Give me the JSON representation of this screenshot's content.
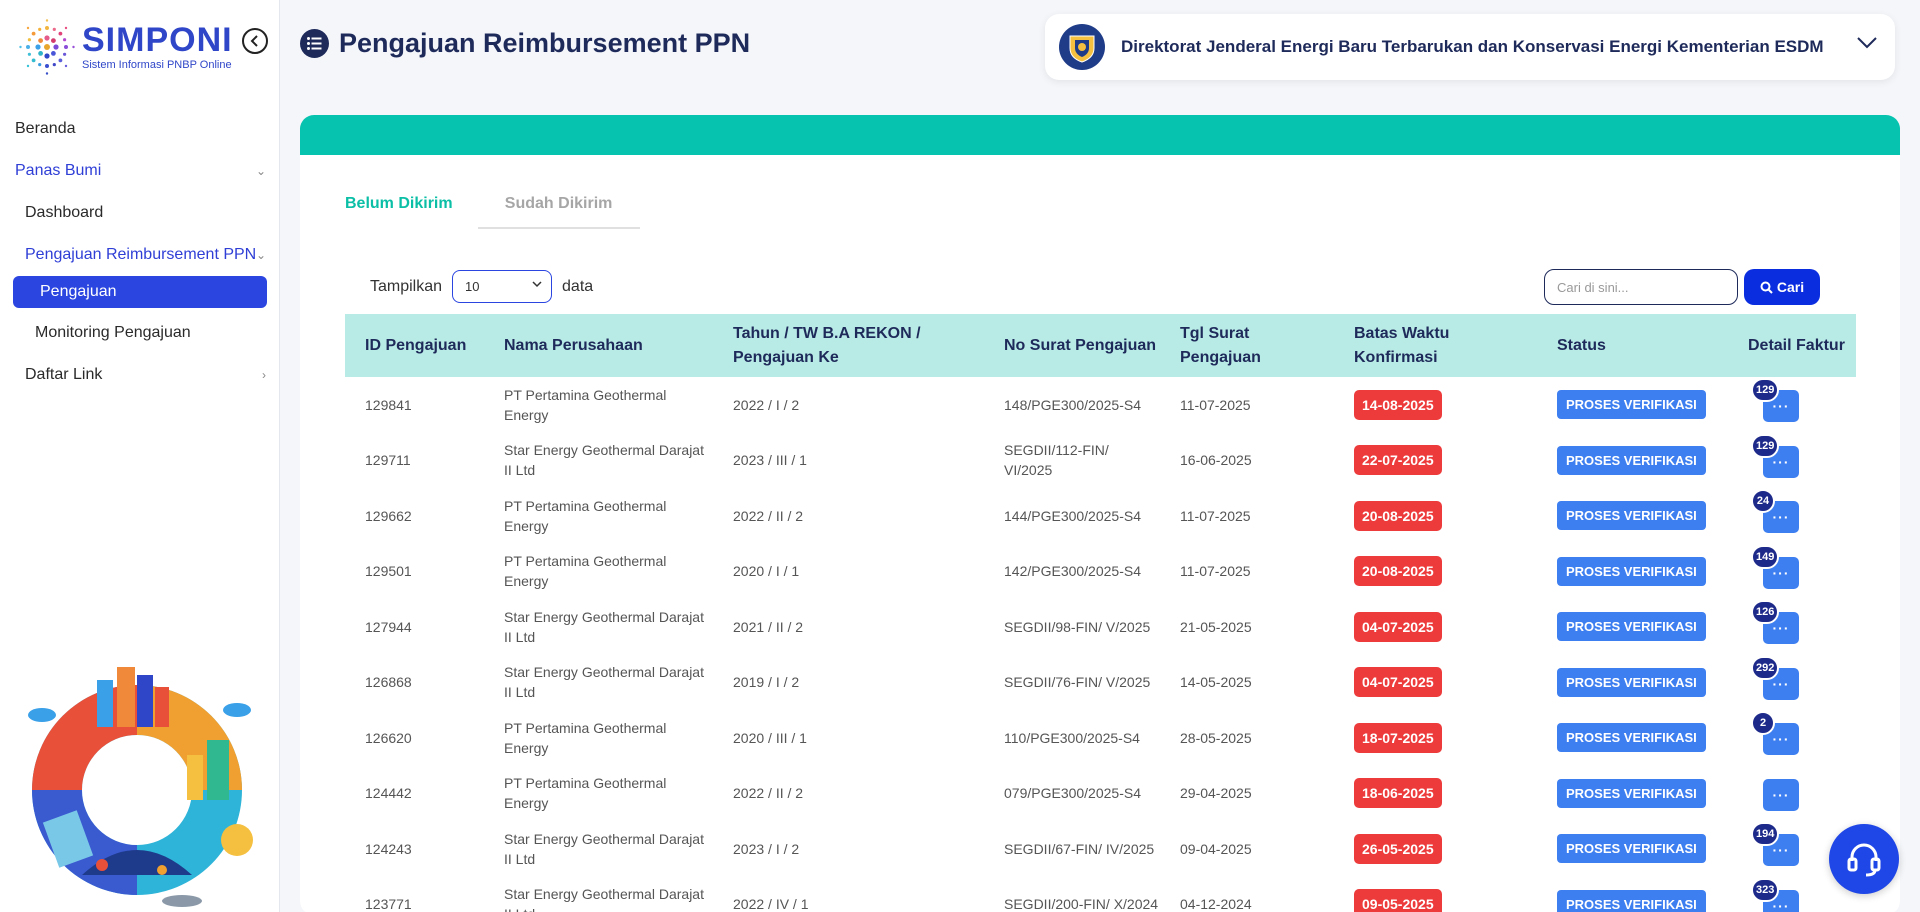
{
  "app": {
    "name": "SIMPONI",
    "tagline": "Sistem Informasi PNBP Online"
  },
  "sidebar": {
    "items": [
      {
        "label": "Beranda"
      },
      {
        "label": "Panas Bumi"
      },
      {
        "label": "Dashboard"
      },
      {
        "label": "Pengajuan Reimbursement PPN"
      },
      {
        "label": "Pengajuan"
      },
      {
        "label": "Monitoring Pengajuan"
      },
      {
        "label": "Daftar Link"
      }
    ]
  },
  "header": {
    "title": "Pengajuan Reimbursement PPN",
    "org_name": "Direktorat Jenderal Energi Baru Terbarukan dan Konservasi Energi Kementerian ESDM"
  },
  "tabs": [
    {
      "label": "Belum Dikirim",
      "active": true
    },
    {
      "label": "Sudah Dikirim",
      "active": false
    }
  ],
  "controls": {
    "show_label": "Tampilkan",
    "page_size": "10",
    "data_label": "data",
    "search_placeholder": "Cari di sini...",
    "search_button": "Cari"
  },
  "table": {
    "columns": [
      "ID Pengajuan",
      "Nama Perusahaan",
      "Tahun / TW B.A REKON / Pengajuan Ke",
      "No Surat Pengajuan",
      "Tgl Surat Pengajuan",
      "Batas Waktu Konfirmasi",
      "Status",
      "Detail Faktur"
    ],
    "detail_button": "···",
    "rows": [
      {
        "id": "129841",
        "company": "PT Pertamina Geothermal Energy",
        "period": "2022 / I / 2",
        "letter_no": "148/PGE300/2025-S4",
        "letter_date": "11-07-2025",
        "deadline": "14-08-2025",
        "status": "PROSES VERIFIKASI",
        "count": "129"
      },
      {
        "id": "129711",
        "company": "Star Energy Geothermal Darajat II Ltd",
        "period": "2023 / III / 1",
        "letter_no": "SEGDII/112-FIN/ VI/2025",
        "letter_date": "16-06-2025",
        "deadline": "22-07-2025",
        "status": "PROSES VERIFIKASI",
        "count": "129"
      },
      {
        "id": "129662",
        "company": "PT Pertamina Geothermal Energy",
        "period": "2022 / II / 2",
        "letter_no": "144/PGE300/2025-S4",
        "letter_date": "11-07-2025",
        "deadline": "20-08-2025",
        "status": "PROSES VERIFIKASI",
        "count": "24"
      },
      {
        "id": "129501",
        "company": "PT Pertamina Geothermal Energy",
        "period": "2020 / I / 1",
        "letter_no": "142/PGE300/2025-S4",
        "letter_date": "11-07-2025",
        "deadline": "20-08-2025",
        "status": "PROSES VERIFIKASI",
        "count": "149"
      },
      {
        "id": "127944",
        "company": "Star Energy Geothermal Darajat II Ltd",
        "period": "2021 / II / 2",
        "letter_no": "SEGDII/98-FIN/ V/2025",
        "letter_date": "21-05-2025",
        "deadline": "04-07-2025",
        "status": "PROSES VERIFIKASI",
        "count": "126"
      },
      {
        "id": "126868",
        "company": "Star Energy Geothermal Darajat II Ltd",
        "period": "2019 / I / 2",
        "letter_no": "SEGDII/76-FIN/ V/2025",
        "letter_date": "14-05-2025",
        "deadline": "04-07-2025",
        "status": "PROSES VERIFIKASI",
        "count": "292"
      },
      {
        "id": "126620",
        "company": "PT Pertamina Geothermal Energy",
        "period": "2020 / III / 1",
        "letter_no": "110/PGE300/2025-S4",
        "letter_date": "28-05-2025",
        "deadline": "18-07-2025",
        "status": "PROSES VERIFIKASI",
        "count": "2"
      },
      {
        "id": "124442",
        "company": "PT Pertamina Geothermal Energy",
        "period": "2022 / II / 2",
        "letter_no": "079/PGE300/2025-S4",
        "letter_date": "29-04-2025",
        "deadline": "18-06-2025",
        "status": "PROSES VERIFIKASI",
        "count": ""
      },
      {
        "id": "124243",
        "company": "Star Energy Geothermal Darajat II Ltd",
        "period": "2023 / I / 2",
        "letter_no": "SEGDII/67-FIN/ IV/2025",
        "letter_date": "09-04-2025",
        "deadline": "26-05-2025",
        "status": "PROSES VERIFIKASI",
        "count": "194"
      },
      {
        "id": "123771",
        "company": "Star Energy Geothermal Darajat II Ltd",
        "period": "2022 / IV / 1",
        "letter_no": "SEGDII/200-FIN/ X/2024",
        "letter_date": "04-12-2024",
        "deadline": "09-05-2025",
        "status": "PROSES VERIFIKASI",
        "count": "323"
      }
    ]
  },
  "colors": {
    "primary": "#2b45e0",
    "teal": "#05c3ae",
    "header_bg": "#b9ebe6",
    "deadline": "#ed3b3b",
    "status": "#3d7ef0",
    "navy": "#1e2a5a"
  }
}
